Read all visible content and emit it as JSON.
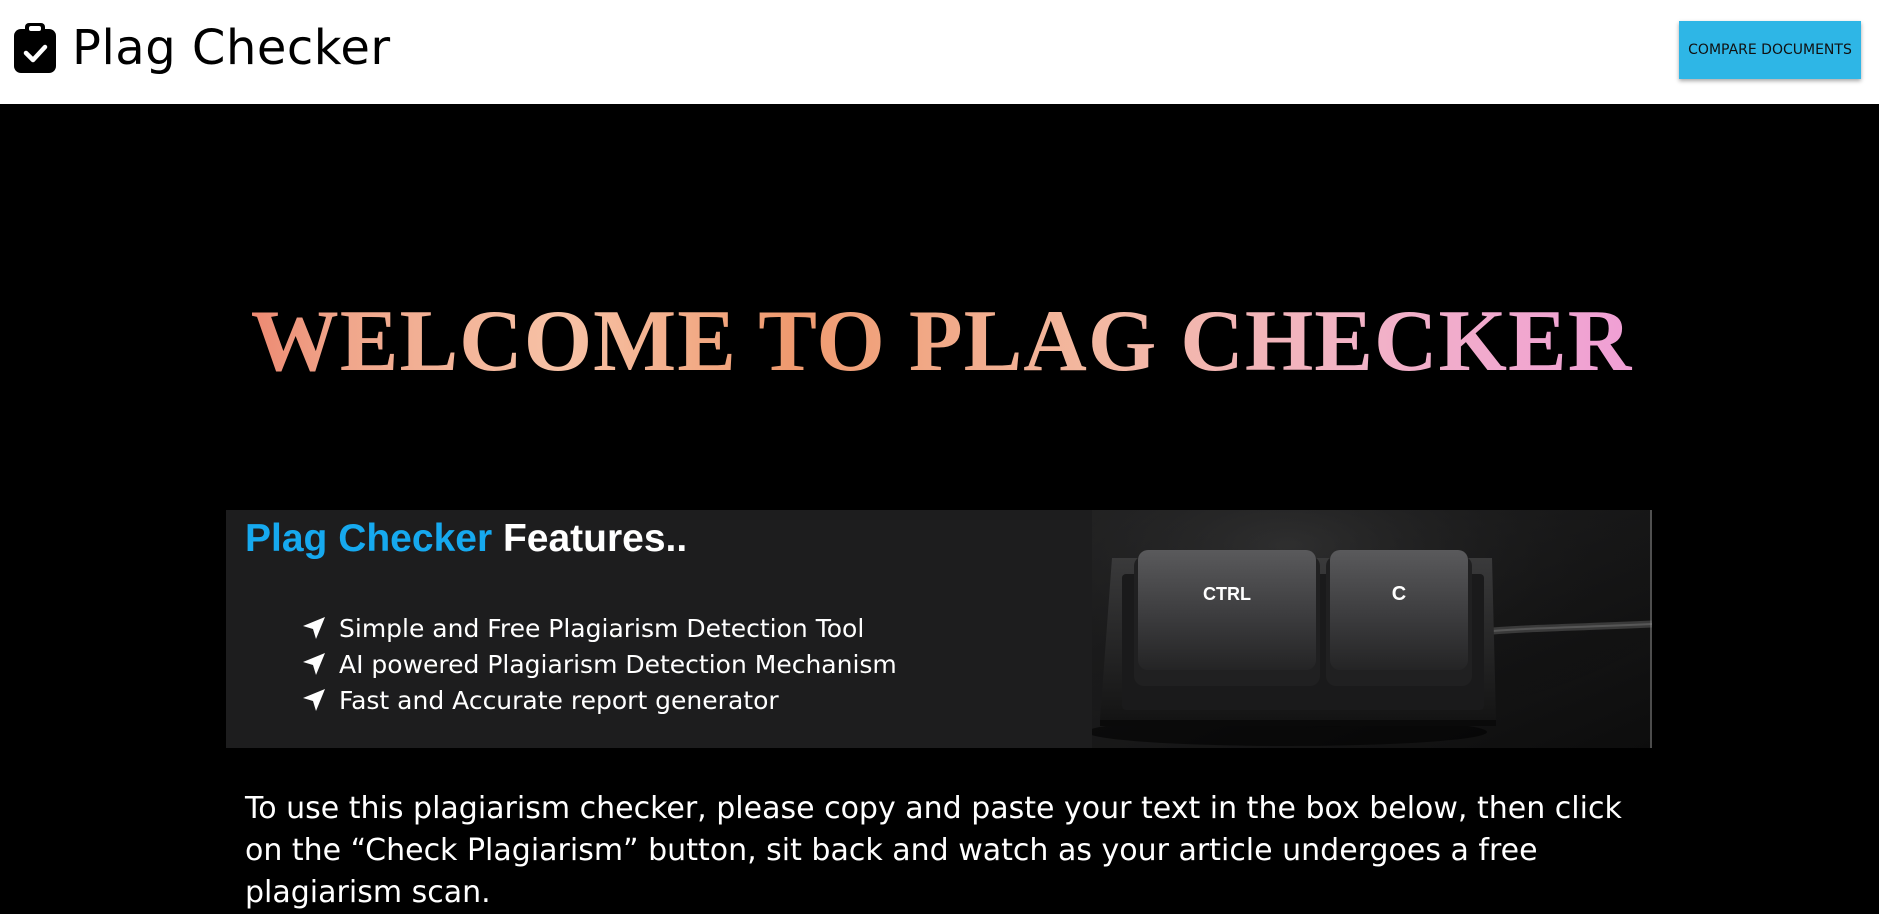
{
  "header": {
    "title": "Plag Checker",
    "logo_icon": "clipboard-check-icon",
    "compare_button_label": "COMPARE DOCUMENTS",
    "button_color": "#2eb6e6"
  },
  "hero": {
    "welcome_text": "WELCOME TO PLAG CHECKER"
  },
  "features": {
    "title_brand": "Plag Checker",
    "title_rest": "Features..",
    "title_brand_color": "#16a9ef",
    "items": [
      {
        "icon": "navigation-arrow-icon",
        "label": "Simple and Free Plagiarism Detection Tool"
      },
      {
        "icon": "navigation-arrow-icon",
        "label": "AI powered Plagiarism Detection Mechanism"
      },
      {
        "icon": "navigation-arrow-icon",
        "label": "Fast and Accurate report generator"
      }
    ],
    "image": {
      "key_1": "CTRL",
      "key_2": "C"
    }
  },
  "instructions": {
    "text": "To use this plagiarism checker, please copy and paste your text in the box below, then click on the “Check Plagiarism” button, sit back and watch as your article undergoes a free plagiarism scan."
  }
}
